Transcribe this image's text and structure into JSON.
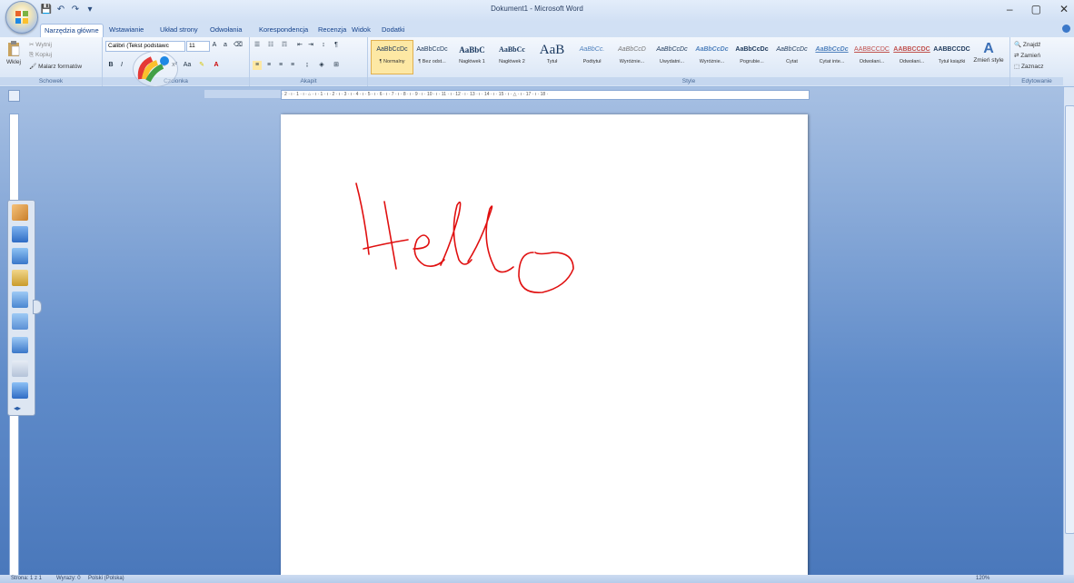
{
  "window": {
    "title": "Dokument1 - Microsoft Word",
    "controls": {
      "minimize": "–",
      "maximize": "▢",
      "close": "✕"
    }
  },
  "quick_access": {
    "save": "💾",
    "undo": "↶",
    "redo": "↷",
    "more": "▾"
  },
  "tabs": [
    "Narzędzia główne",
    "Wstawianie",
    "Układ strony",
    "Odwołania",
    "Korespondencja",
    "Recenzja",
    "Widok",
    "Dodatki"
  ],
  "ribbon": {
    "clipboard": {
      "paste": "Wklej",
      "cut": "Wytnij",
      "copy": "Kopiuj",
      "format_painter": "Malarz formatów",
      "label": "Schowek"
    },
    "font": {
      "family": "Calibri (Tekst podstawc",
      "size": "11",
      "label": "Czcionka"
    },
    "paragraph": {
      "label": "Akapit"
    },
    "styles": {
      "label": "Style",
      "items": [
        {
          "sample": "AaBbCcDc",
          "name": "¶ Normalny"
        },
        {
          "sample": "AaBbCcDc",
          "name": "¶ Bez odst..."
        },
        {
          "sample": "AaBbC",
          "name": "Nagłówek 1"
        },
        {
          "sample": "AaBbCc",
          "name": "Nagłówek 2"
        },
        {
          "sample": "AaB",
          "name": "Tytuł"
        },
        {
          "sample": "AaBbCc.",
          "name": "Podtytuł"
        },
        {
          "sample": "AaBbCcD",
          "name": "Wyróżnie..."
        },
        {
          "sample": "AaBbCcDc",
          "name": "Uwydatni..."
        },
        {
          "sample": "AaBbCcDc",
          "name": "Wyróżnie..."
        },
        {
          "sample": "AaBbCcDc",
          "name": "Pogrubie..."
        },
        {
          "sample": "AaBbCcDc",
          "name": "Cytat"
        },
        {
          "sample": "AaBbCcDc",
          "name": "Cytat inte..."
        },
        {
          "sample": "AABBCCDC",
          "name": "Odwołani..."
        },
        {
          "sample": "AABBCCDC",
          "name": "Odwołani..."
        },
        {
          "sample": "AABBCCDC",
          "name": "Tytuł książki"
        }
      ],
      "change": "Zmień style"
    },
    "editing": {
      "find": "Znajdź",
      "replace": "Zamień",
      "select": "Zaznacz",
      "label": "Edytowanie"
    }
  },
  "document": {
    "ink_text": "Hello",
    "ink_color": "#e01010"
  },
  "ruler": {
    "marks": "· 2 · ı · 1 · ı · ⌂ · ı · 1 · ı · 2 · ı · 3 · ı · 4 · ı · 5 · ı · 6 · ı · 7 · ı · 8 · ı · 9 · ı · 10 · ı · 11 · ı · 12 · ı · 13 · ı · 14 · ı · 15 · ı · △ · ı · 17 · ı · 18 ·"
  },
  "status": {
    "page": "Strona: 1 z 1",
    "words": "Wyrazy: 0",
    "language": "Polski (Polska)",
    "zoom": "120%"
  }
}
